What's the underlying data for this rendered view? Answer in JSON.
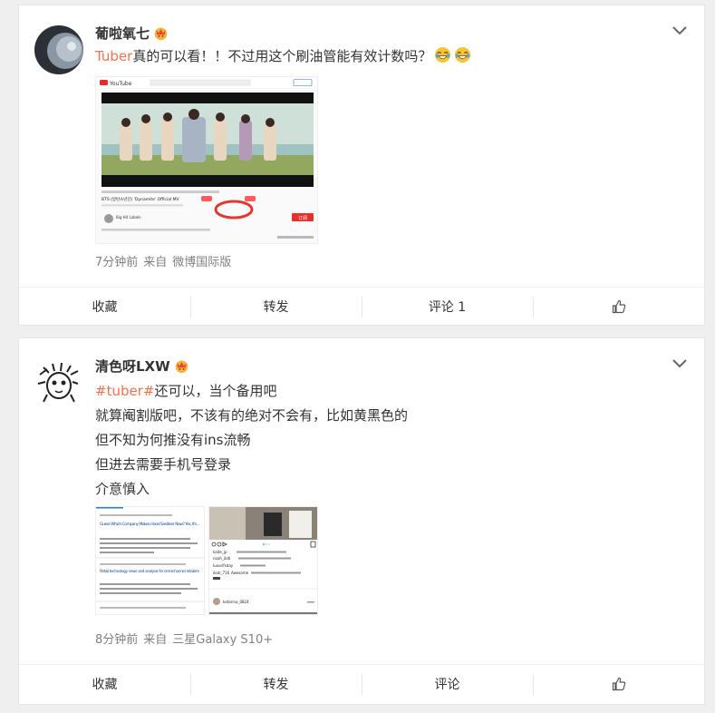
{
  "posts": [
    {
      "username": "葡啦氧七",
      "text_highlight": "Tuber",
      "text": "真的可以看！！不过用这个刷油管能有效计数吗？",
      "emojis": [
        "laugh-cry-emoji",
        "laugh-cry-emoji"
      ],
      "time": "7分钟前",
      "source_prefix": "来自",
      "source": "微博国际版",
      "actions": {
        "favorite": "收藏",
        "repost": "转发",
        "comment": "评论 1"
      },
      "image_text": {
        "logo": "YouTube",
        "video_title": "BTS (방탄소년단) 'Dynamite' Official MV",
        "channel": "Big Hit Labels",
        "subscribe": "订阅"
      }
    },
    {
      "username": "清色呀LXW",
      "hashtag": "#tuber#",
      "lines": [
        "还可以，当个备用吧",
        "就算阉割版吧，不该有的绝对不会有，比如黄黑色的",
        "但不知为何推没有ins流畅",
        "但进去需要手机号登录",
        "介意慎入"
      ],
      "time": "8分钟前",
      "source_prefix": "来自",
      "source": "三星Galaxy S10+",
      "actions": {
        "favorite": "收藏",
        "repost": "转发",
        "comment": "评论"
      },
      "image_text": {
        "headline1": "Guess Which Company Makes Hand Sanitiser Now? Yes, It's...",
        "headline2": "Retail technology news and analysis for omnichannel retailers",
        "comment1_user": "kaite_jp",
        "comment2_user": "noah_ibiti",
        "comment3_user": "luxurifsday",
        "comment4_user": "ikati_716",
        "comment4_text": "Awesome",
        "bottom_user": "katarina_0824"
      }
    }
  ],
  "colors": {
    "accent": "#eb7350",
    "text": "#333333",
    "meta": "#808080",
    "background": "#efefef"
  }
}
